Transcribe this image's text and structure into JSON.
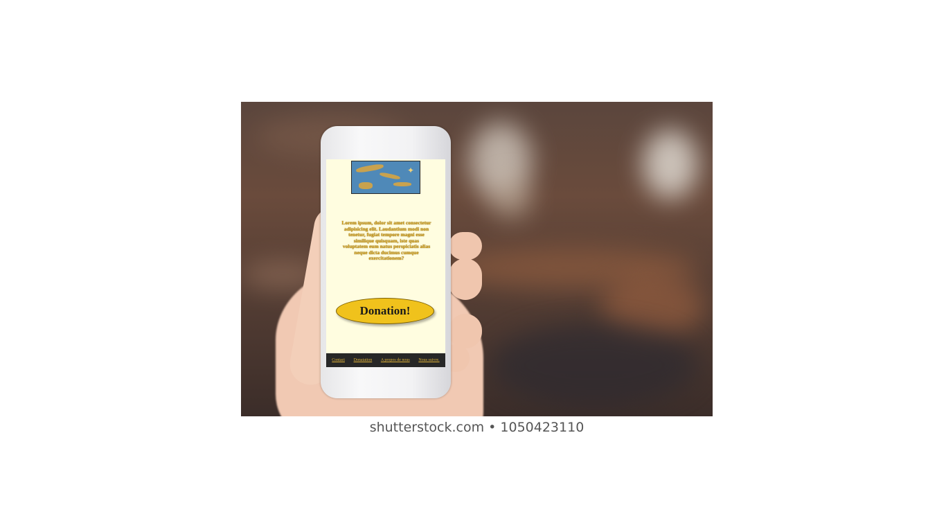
{
  "phone_page": {
    "lorem_text": "Lorem ipsum, dolor sit amet consectetur adipisicing elit. Laudantium modi non tenetur, fugiat tempore magni esse similique quisquam, iste quas voluptatem eum natus perspiciatis alias neque dicta ducimus cumque exercitationem?",
    "donation_button_label": "Donation!",
    "footer_links": [
      "Contact",
      "Donatation",
      "A propos de nous",
      "Nous suivre."
    ],
    "map_image": "map-icon"
  },
  "caption": "shutterstock.com • 1050423110",
  "colors": {
    "screen_bg": "#fffde0",
    "button_bg": "#f0c21c",
    "footer_bg": "#272727",
    "text_gold": "#d4a017"
  }
}
